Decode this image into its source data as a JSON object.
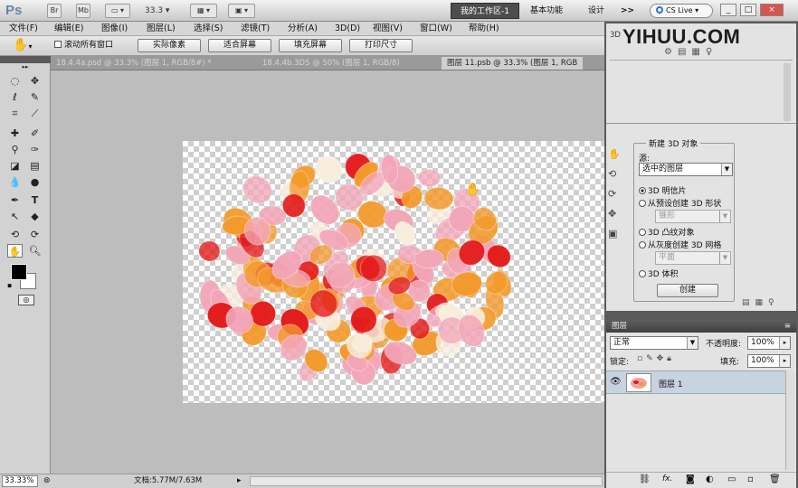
{
  "app": {
    "logo": "Ps",
    "top_icons": [
      "Br",
      "Mb"
    ],
    "zoom_field": "33.3",
    "workspaces": {
      "active": "我的工作区-1",
      "tabs": [
        "基本功能",
        "设计"
      ],
      "more": ">>"
    },
    "cs_live": "CS Live",
    "window_controls": [
      "_",
      "□",
      "×"
    ]
  },
  "menu": [
    "文件(F)",
    "编辑(E)",
    "图像(I)",
    "图层(L)",
    "选择(S)",
    "滤镜(T)",
    "分析(A)",
    "3D(D)",
    "视图(V)",
    "窗口(W)",
    "帮助(H)"
  ],
  "options_bar": {
    "tool_icon": "hand-icon",
    "checkbox_label": "滚动所有窗口",
    "buttons": [
      "实际像素",
      "适合屏幕",
      "填充屏幕",
      "打印尺寸"
    ]
  },
  "doc_tabs": [
    "18.4.4a.psd @ 33.3% (图层 1, RGB/8#) *",
    "18.4.4b.3DS @ 50% (图层 1, RGB/8)",
    "图层 11.psb @ 33.3% (图层 1, RGB"
  ],
  "status": {
    "zoom": "33.33%",
    "doc_info": "文档:5.77M/7.63M"
  },
  "panel_3d": {
    "label": "3D",
    "watermark": "YIHUU.COM",
    "group_title": "新建 3D 对象",
    "source_label": "源:",
    "source_value": "选中的图层",
    "options": [
      "3D 明信片",
      "从预设创建 3D 形状",
      "3D 凸纹对象",
      "从灰度创建 3D 网格",
      "3D 体积"
    ],
    "selected_index": 0,
    "sub_select_1": "锥形",
    "sub_select_2": "平面",
    "create_button": "创建"
  },
  "layers_panel": {
    "title": "图层",
    "blend_mode": "正常",
    "opacity_label": "不透明度:",
    "opacity_value": "100%",
    "lock_label": "锁定:",
    "fill_label": "填充:",
    "fill_value": "100%",
    "layers": [
      {
        "name": "图层 1",
        "visible": true
      }
    ],
    "footer_icons": [
      "link-icon",
      "fx-icon",
      "mask-icon",
      "adjustment-icon",
      "group-icon",
      "new-layer-icon",
      "trash-icon"
    ]
  },
  "colors": {
    "petal_red": "#e31b1b",
    "petal_orange": "#f39a2c",
    "petal_pink": "#f2a6b8",
    "petal_cream": "#f7eedd"
  }
}
